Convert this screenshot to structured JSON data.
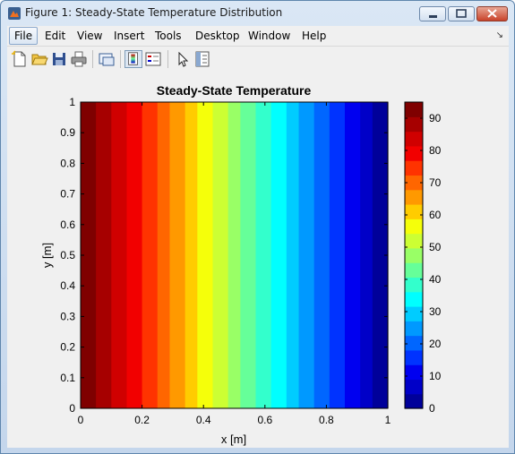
{
  "window": {
    "title": "Figure 1: Steady-State Temperature Distribution",
    "app_icon": "matlab-figure-icon",
    "controls": [
      "minimize-icon",
      "maximize-icon",
      "close-icon"
    ]
  },
  "menubar": {
    "items": [
      "File",
      "Edit",
      "View",
      "Insert",
      "Tools",
      "Desktop",
      "Window",
      "Help"
    ],
    "active": "File",
    "dock_icon": "dock-arrow-icon"
  },
  "toolbar": {
    "icons": [
      "new-figure-icon",
      "open-file-icon",
      "save-icon",
      "print-icon",
      "link-plot-icon",
      "colorbar-toggle-icon",
      "legend-toggle-icon",
      "pointer-icon",
      "property-editor-icon"
    ]
  },
  "chart_data": {
    "type": "heatmap",
    "title": "Steady-State Temperature",
    "xlabel": "x [m]",
    "ylabel": "y [m]",
    "xlim": [
      0,
      1
    ],
    "ylim": [
      0,
      1
    ],
    "x_ticks": [
      "0",
      "0.2",
      "0.4",
      "0.6",
      "0.8",
      "1"
    ],
    "y_ticks": [
      "0",
      "0.1",
      "0.2",
      "0.3",
      "0.4",
      "0.5",
      "0.6",
      "0.7",
      "0.8",
      "0.9",
      "1"
    ],
    "colormap": "jet",
    "clim": [
      0,
      95
    ],
    "bands": [
      {
        "x0": 0.0,
        "x1": 0.05,
        "color": "#7f0000"
      },
      {
        "x0": 0.05,
        "x1": 0.1,
        "color": "#a60000"
      },
      {
        "x0": 0.1,
        "x1": 0.15,
        "color": "#d00000"
      },
      {
        "x0": 0.15,
        "x1": 0.2,
        "color": "#f20000"
      },
      {
        "x0": 0.2,
        "x1": 0.25,
        "color": "#ff3300"
      },
      {
        "x0": 0.25,
        "x1": 0.29,
        "color": "#ff6600"
      },
      {
        "x0": 0.29,
        "x1": 0.34,
        "color": "#ff9900"
      },
      {
        "x0": 0.34,
        "x1": 0.38,
        "color": "#ffcc00"
      },
      {
        "x0": 0.38,
        "x1": 0.43,
        "color": "#f5ff0a"
      },
      {
        "x0": 0.43,
        "x1": 0.48,
        "color": "#ccff33"
      },
      {
        "x0": 0.48,
        "x1": 0.52,
        "color": "#99ff66"
      },
      {
        "x0": 0.52,
        "x1": 0.57,
        "color": "#66ff99"
      },
      {
        "x0": 0.57,
        "x1": 0.62,
        "color": "#33ffcc"
      },
      {
        "x0": 0.62,
        "x1": 0.67,
        "color": "#00ffff"
      },
      {
        "x0": 0.67,
        "x1": 0.71,
        "color": "#00ccff"
      },
      {
        "x0": 0.71,
        "x1": 0.76,
        "color": "#0099ff"
      },
      {
        "x0": 0.76,
        "x1": 0.81,
        "color": "#0066ff"
      },
      {
        "x0": 0.81,
        "x1": 0.86,
        "color": "#0033ff"
      },
      {
        "x0": 0.86,
        "x1": 0.91,
        "color": "#0000f0"
      },
      {
        "x0": 0.91,
        "x1": 0.95,
        "color": "#0000c8"
      },
      {
        "x0": 0.95,
        "x1": 1.0,
        "color": "#00009a"
      }
    ],
    "colorbar": {
      "ticks": [
        "0",
        "10",
        "20",
        "30",
        "40",
        "50",
        "60",
        "70",
        "80",
        "90"
      ],
      "tick_values": [
        0,
        10,
        20,
        30,
        40,
        50,
        60,
        70,
        80,
        90
      ],
      "range": [
        0,
        95
      ],
      "colors": [
        "#00009a",
        "#0000c8",
        "#0000f0",
        "#0033ff",
        "#0066ff",
        "#0099ff",
        "#00ccff",
        "#00ffff",
        "#33ffcc",
        "#66ff99",
        "#99ff66",
        "#ccff33",
        "#f5ff0a",
        "#ffcc00",
        "#ff9900",
        "#ff6600",
        "#ff3300",
        "#f20000",
        "#d00000",
        "#a60000",
        "#7f0000"
      ]
    }
  }
}
